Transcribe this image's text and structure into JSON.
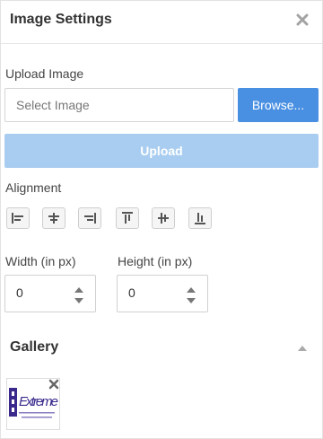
{
  "header": {
    "title": "Image Settings",
    "close_icon": "close-icon"
  },
  "upload": {
    "label": "Upload Image",
    "placeholder": "Select Image",
    "browse_label": "Browse...",
    "upload_label": "Upload"
  },
  "alignment": {
    "label": "Alignment",
    "buttons": [
      "align-left-icon",
      "align-center-icon",
      "align-right-icon",
      "align-top-icon",
      "align-middle-icon",
      "align-bottom-icon"
    ]
  },
  "size": {
    "width_label": "Width (in px)",
    "width_value": "0",
    "height_label": "Height (in px)",
    "height_value": "0"
  },
  "gallery": {
    "title": "Gallery",
    "collapse_icon": "caret-up-icon",
    "items": [
      {
        "logo_text": "Extreme",
        "delete_icon": "close-icon"
      }
    ]
  },
  "colors": {
    "primary": "#4a90e2",
    "primary_disabled": "#a9cdf0",
    "border": "#d5d5d5",
    "logo_purple": "#3b2a8c"
  }
}
